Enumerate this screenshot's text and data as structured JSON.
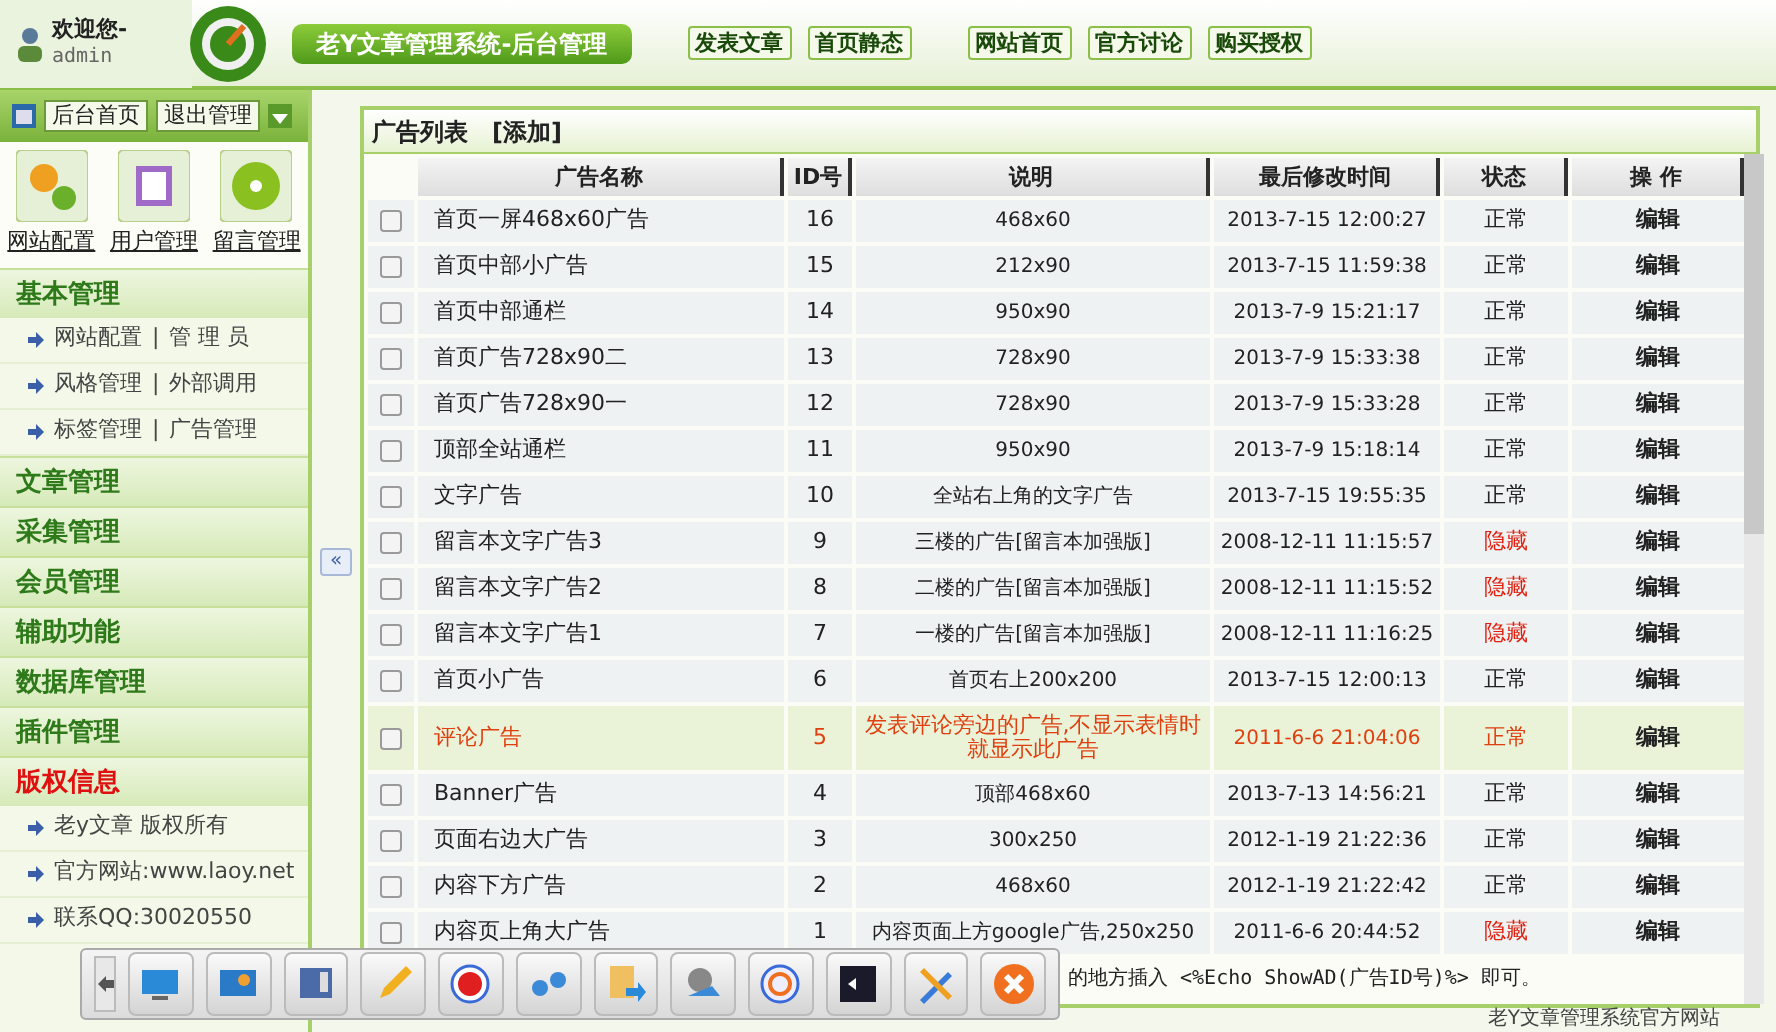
{
  "header": {
    "welcome": "欢迎您-",
    "user": "admin",
    "title": "老Y文章管理系统-后台管理",
    "links": [
      "发表文章",
      "首页静态",
      "网站首页",
      "官方讨论",
      "购买授权"
    ]
  },
  "sidebar": {
    "top_buttons": [
      "后台首页",
      "退出管理"
    ],
    "shortcuts": [
      "网站配置",
      "用户管理",
      "留言管理"
    ],
    "sections": [
      {
        "title": "基本管理",
        "kind": "normal",
        "items": [
          [
            "网站配置",
            "|",
            "管 理 员"
          ],
          [
            "风格管理",
            "|",
            "外部调用"
          ],
          [
            "标签管理",
            "|",
            "广告管理"
          ]
        ]
      },
      {
        "title": "文章管理",
        "kind": "normal"
      },
      {
        "title": "采集管理",
        "kind": "normal"
      },
      {
        "title": "会员管理",
        "kind": "normal"
      },
      {
        "title": "辅助功能",
        "kind": "normal"
      },
      {
        "title": "数据库管理",
        "kind": "normal"
      },
      {
        "title": "插件管理",
        "kind": "normal"
      },
      {
        "title": "版权信息",
        "kind": "alert",
        "items": [
          [
            "老y文章 版权所有"
          ],
          [
            "官方网站:www.laoy.net"
          ],
          [
            "联系QQ:30020550"
          ]
        ]
      }
    ]
  },
  "collapse_button": "«",
  "panel": {
    "title": "广告列表",
    "add": "[添加]",
    "columns": [
      "广告名称",
      "ID号",
      "说明",
      "最后修改时间",
      "状态",
      "操 作"
    ],
    "rows": [
      {
        "checked": false,
        "highlighted": false,
        "name": "首页一屏468x60广告",
        "id": "16",
        "desc": "468x60",
        "time": "2013-7-15 12:00:27",
        "status": "正常",
        "hidden": false,
        "action": "编辑"
      },
      {
        "checked": false,
        "highlighted": false,
        "name": "首页中部小广告",
        "id": "15",
        "desc": "212x90",
        "time": "2013-7-15 11:59:38",
        "status": "正常",
        "hidden": false,
        "action": "编辑"
      },
      {
        "checked": false,
        "highlighted": false,
        "name": "首页中部通栏",
        "id": "14",
        "desc": "950x90",
        "time": "2013-7-9 15:21:17",
        "status": "正常",
        "hidden": false,
        "action": "编辑"
      },
      {
        "checked": false,
        "highlighted": false,
        "name": "首页广告728x90二",
        "id": "13",
        "desc": "728x90",
        "time": "2013-7-9 15:33:38",
        "status": "正常",
        "hidden": false,
        "action": "编辑"
      },
      {
        "checked": false,
        "highlighted": false,
        "name": "首页广告728x90一",
        "id": "12",
        "desc": "728x90",
        "time": "2013-7-9 15:33:28",
        "status": "正常",
        "hidden": false,
        "action": "编辑"
      },
      {
        "checked": false,
        "highlighted": false,
        "name": "顶部全站通栏",
        "id": "11",
        "desc": "950x90",
        "time": "2013-7-9 15:18:14",
        "status": "正常",
        "hidden": false,
        "action": "编辑"
      },
      {
        "checked": false,
        "highlighted": false,
        "name": "文字广告",
        "id": "10",
        "desc": "全站右上角的文字广告",
        "time": "2013-7-15 19:55:35",
        "status": "正常",
        "hidden": false,
        "action": "编辑"
      },
      {
        "checked": false,
        "highlighted": false,
        "name": "留言本文字广告3",
        "id": "9",
        "desc": "三楼的广告[留言本加强版]",
        "time": "2008-12-11 11:15:57",
        "status": "隐藏",
        "hidden": true,
        "action": "编辑"
      },
      {
        "checked": false,
        "highlighted": false,
        "name": "留言本文字广告2",
        "id": "8",
        "desc": "二楼的广告[留言本加强版]",
        "time": "2008-12-11 11:15:52",
        "status": "隐藏",
        "hidden": true,
        "action": "编辑"
      },
      {
        "checked": false,
        "highlighted": false,
        "name": "留言本文字广告1",
        "id": "7",
        "desc": "一楼的广告[留言本加强版]",
        "time": "2008-12-11 11:16:25",
        "status": "隐藏",
        "hidden": true,
        "action": "编辑"
      },
      {
        "checked": false,
        "highlighted": false,
        "name": "首页小广告",
        "id": "6",
        "desc": "首页右上200x200",
        "time": "2013-7-15 12:00:13",
        "status": "正常",
        "hidden": false,
        "action": "编辑"
      },
      {
        "checked": false,
        "highlighted": true,
        "name": "评论广告",
        "id": "5",
        "desc": "发表评论旁边的广告,不显示表情时就显示此广告",
        "time": "2011-6-6 21:04:06",
        "status": "正常",
        "hidden": false,
        "action": "编辑"
      },
      {
        "checked": false,
        "highlighted": false,
        "name": "Banner广告",
        "id": "4",
        "desc": "顶部468x60",
        "time": "2013-7-13 14:56:21",
        "status": "正常",
        "hidden": false,
        "action": "编辑"
      },
      {
        "checked": false,
        "highlighted": false,
        "name": "页面右边大广告",
        "id": "3",
        "desc": "300x250",
        "time": "2012-1-19 21:22:36",
        "status": "正常",
        "hidden": false,
        "action": "编辑"
      },
      {
        "checked": false,
        "highlighted": false,
        "name": "内容下方广告",
        "id": "2",
        "desc": "468x60",
        "time": "2012-1-19 21:22:42",
        "status": "正常",
        "hidden": false,
        "action": "编辑"
      },
      {
        "checked": false,
        "highlighted": false,
        "name": "内容页上角大广告",
        "id": "1",
        "desc": "内容页面上方google广告,250x250",
        "time": "2011-6-6 20:44:52",
        "status": "隐藏",
        "hidden": true,
        "action": "编辑"
      }
    ],
    "note": "的地方插入 <%Echo ShowAD(广告ID号)%> 即可。"
  },
  "footer": {
    "link": "老Y文章管理系统官方网站"
  }
}
